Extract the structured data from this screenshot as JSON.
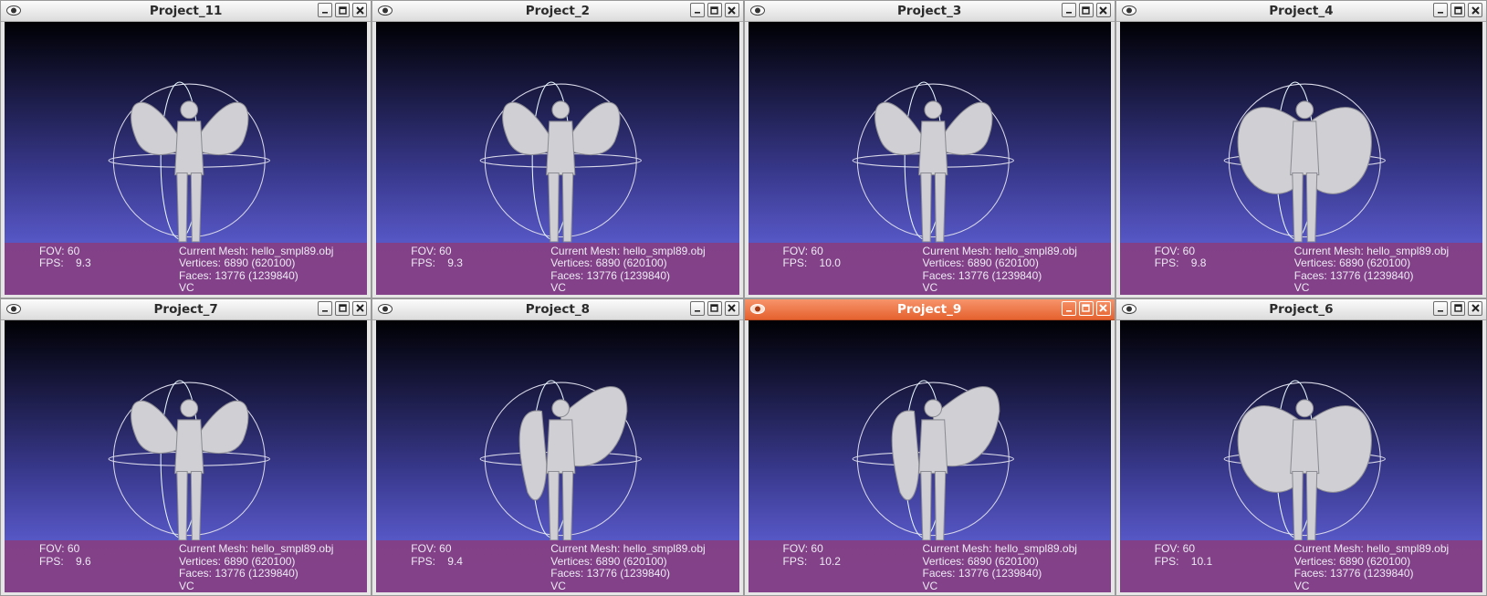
{
  "windows": [
    {
      "title": "Project_11",
      "fov": "FOV: 60",
      "fps_label": "FPS:",
      "fps_value": "9.3",
      "mesh": "Current Mesh: hello_smpl89.obj",
      "vertices": "Vertices: 6890 (620100)",
      "faces": "Faces: 13776 (1239840)",
      "vc": "VC",
      "active": false,
      "pose": "arms-up"
    },
    {
      "title": "Project_2",
      "fov": "FOV: 60",
      "fps_label": "FPS:",
      "fps_value": "9.3",
      "mesh": "Current Mesh: hello_smpl89.obj",
      "vertices": "Vertices: 6890 (620100)",
      "faces": "Faces: 13776 (1239840)",
      "vc": "VC",
      "active": false,
      "pose": "arms-up"
    },
    {
      "title": "Project_3",
      "fov": "FOV: 60",
      "fps_label": "FPS:",
      "fps_value": "10.0",
      "mesh": "Current Mesh: hello_smpl89.obj",
      "vertices": "Vertices: 6890 (620100)",
      "faces": "Faces: 13776 (1239840)",
      "vc": "VC",
      "active": false,
      "pose": "arms-up"
    },
    {
      "title": "Project_4",
      "fov": "FOV: 60",
      "fps_label": "FPS:",
      "fps_value": "9.8",
      "mesh": "Current Mesh: hello_smpl89.obj",
      "vertices": "Vertices: 6890 (620100)",
      "faces": "Faces: 13776 (1239840)",
      "vc": "VC",
      "active": false,
      "pose": "arms-down"
    },
    {
      "title": "Project_7",
      "fov": "FOV: 60",
      "fps_label": "FPS:",
      "fps_value": "9.6",
      "mesh": "Current Mesh: hello_smpl89.obj",
      "vertices": "Vertices: 6890 (620100)",
      "faces": "Faces: 13776 (1239840)",
      "vc": "VC",
      "active": false,
      "pose": "arms-up"
    },
    {
      "title": "Project_8",
      "fov": "FOV: 60",
      "fps_label": "FPS:",
      "fps_value": "9.4",
      "mesh": "Current Mesh: hello_smpl89.obj",
      "vertices": "Vertices: 6890 (620100)",
      "faces": "Faces: 13776 (1239840)",
      "vc": "VC",
      "active": false,
      "pose": "side"
    },
    {
      "title": "Project_9",
      "fov": "FOV: 60",
      "fps_label": "FPS:",
      "fps_value": "10.2",
      "mesh": "Current Mesh: hello_smpl89.obj",
      "vertices": "Vertices: 6890 (620100)",
      "faces": "Faces: 13776 (1239840)",
      "vc": "VC",
      "active": true,
      "pose": "side"
    },
    {
      "title": "Project_6",
      "fov": "FOV: 60",
      "fps_label": "FPS:",
      "fps_value": "10.1",
      "mesh": "Current Mesh: hello_smpl89.obj",
      "vertices": "Vertices: 6890 (620100)",
      "faces": "Faces: 13776 (1239840)",
      "vc": "VC",
      "active": false,
      "pose": "arms-down"
    }
  ],
  "colors": {
    "active_titlebar": "#e5622f",
    "info_panel": "#893e80",
    "viewport_bottom": "#5e5ecc",
    "mesh": "#cfcfd4"
  },
  "icons": {
    "app": "meshlab-eye-icon",
    "minimize": "minimize-icon",
    "maximize": "maximize-icon",
    "close": "close-icon"
  }
}
